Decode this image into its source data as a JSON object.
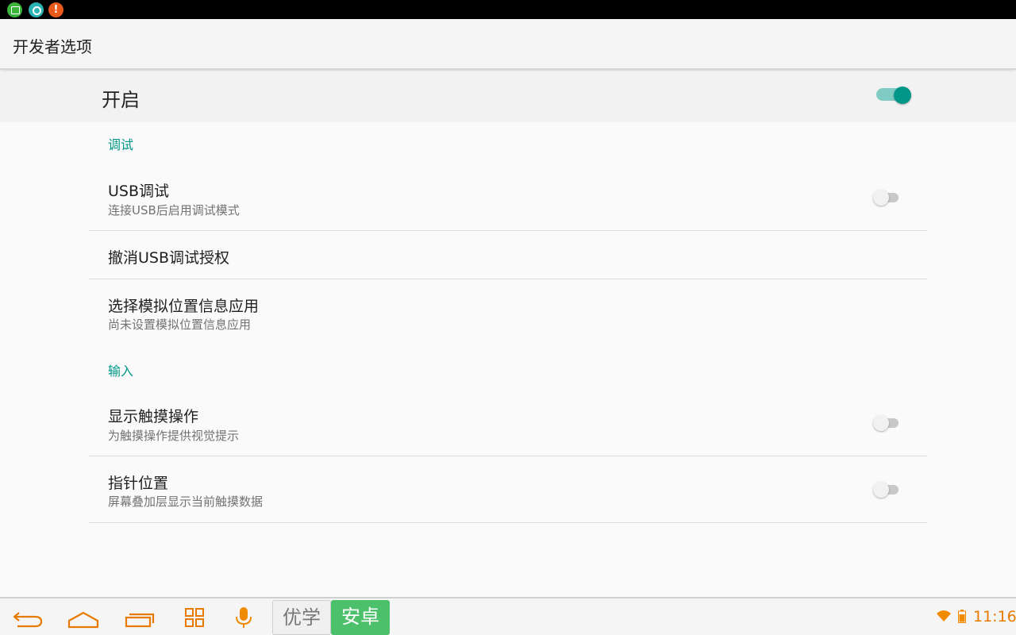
{
  "screen": {
    "title": "开发者选项"
  },
  "master": {
    "label": "开启",
    "enabled": true
  },
  "sections": {
    "debug": {
      "header": "调试"
    },
    "input": {
      "header": "输入"
    }
  },
  "prefs": {
    "usb_debug": {
      "title": "USB调试",
      "summary": "连接USB后启用调试模式",
      "checked": false
    },
    "revoke_usb": {
      "title": "撤消USB调试授权"
    },
    "mock_location": {
      "title": "选择模拟位置信息应用",
      "summary": "尚未设置模拟位置信息应用"
    },
    "show_touches": {
      "title": "显示触摸操作",
      "summary": "为触摸操作提供视觉提示",
      "checked": false
    },
    "pointer_location": {
      "title": "指针位置",
      "summary": "屏幕叠加层显示当前触摸数据",
      "checked": false
    }
  },
  "navbar": {
    "ime_left": "优学",
    "ime_right": "安卓",
    "clock": "11:16",
    "accent": "#e87a00"
  },
  "notifications": {
    "alert_glyph": "!"
  }
}
